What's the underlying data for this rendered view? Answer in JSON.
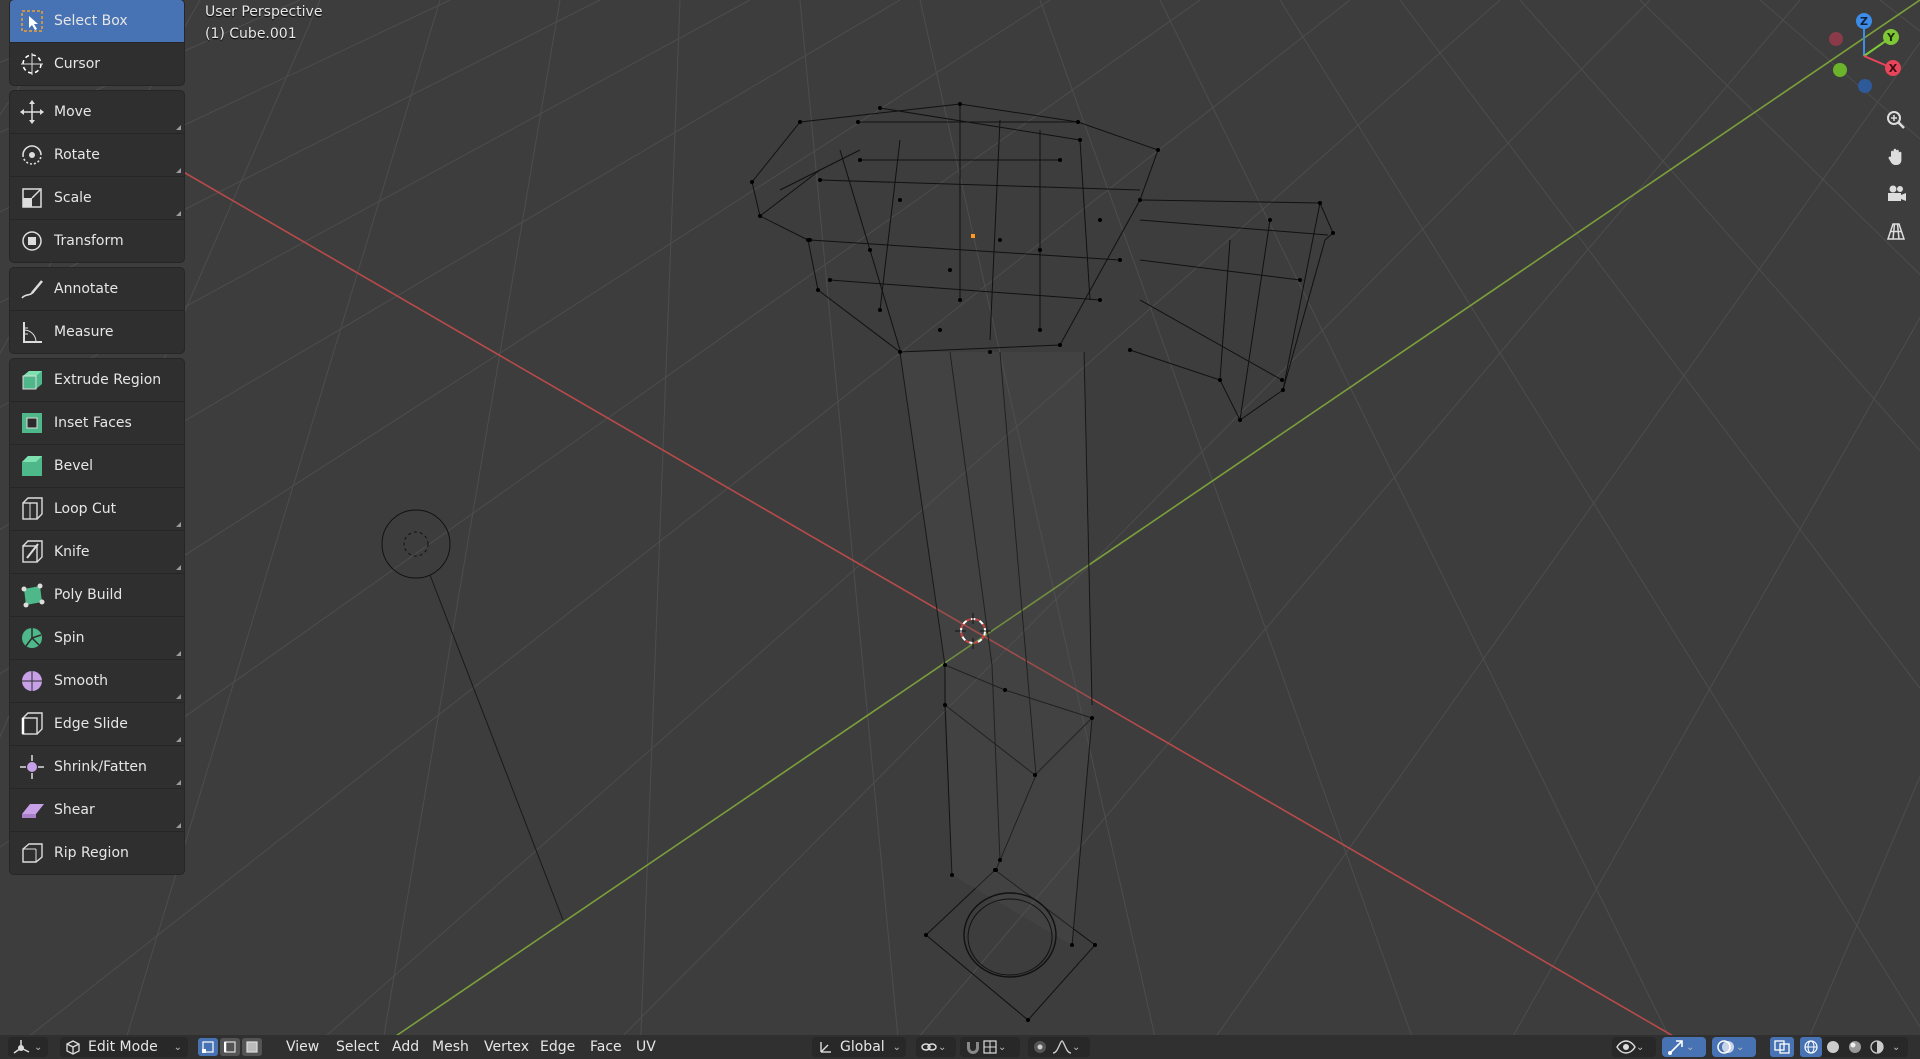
{
  "viewport": {
    "perspective_label": "User Perspective",
    "object_label": "(1) Cube.001"
  },
  "toolbar": {
    "groups": [
      [
        {
          "label": "Select Box",
          "icon": "select-box-icon",
          "active": true
        },
        {
          "label": "Cursor",
          "icon": "cursor-icon"
        }
      ],
      [
        {
          "label": "Move",
          "icon": "move-icon"
        },
        {
          "label": "Rotate",
          "icon": "rotate-icon"
        },
        {
          "label": "Scale",
          "icon": "scale-icon"
        },
        {
          "label": "Transform",
          "icon": "transform-icon"
        }
      ],
      [
        {
          "label": "Annotate",
          "icon": "annotate-icon"
        },
        {
          "label": "Measure",
          "icon": "measure-icon"
        }
      ],
      [
        {
          "label": "Extrude Region",
          "icon": "extrude-region-icon"
        },
        {
          "label": "Inset Faces",
          "icon": "inset-faces-icon"
        },
        {
          "label": "Bevel",
          "icon": "bevel-icon"
        },
        {
          "label": "Loop Cut",
          "icon": "loop-cut-icon"
        },
        {
          "label": "Knife",
          "icon": "knife-icon"
        },
        {
          "label": "Poly Build",
          "icon": "poly-build-icon"
        },
        {
          "label": "Spin",
          "icon": "spin-icon"
        },
        {
          "label": "Smooth",
          "icon": "smooth-icon"
        },
        {
          "label": "Edge Slide",
          "icon": "edge-slide-icon"
        },
        {
          "label": "Shrink/Fatten",
          "icon": "shrink-fatten-icon"
        },
        {
          "label": "Shear",
          "icon": "shear-icon"
        },
        {
          "label": "Rip Region",
          "icon": "rip-region-icon"
        }
      ]
    ]
  },
  "gizmo": {
    "axis_z": "Z",
    "axis_y": "Y",
    "axis_x": "X",
    "colors": {
      "x": "#e8445a",
      "y": "#7fc736",
      "z": "#3d8ce8"
    }
  },
  "nav_buttons": [
    "zoom-icon",
    "hand-pan-icon",
    "camera-icon",
    "grid-ortho-icon"
  ],
  "header": {
    "mode": "Edit Mode",
    "menus": [
      "View",
      "Select",
      "Add",
      "Mesh",
      "Vertex",
      "Edge",
      "Face",
      "UV"
    ],
    "transform_orientation": "Global"
  },
  "colors": {
    "background": "#3d3d3d",
    "grid": "#4d4d4d",
    "axis_x_line": "#b84a4a",
    "axis_y_line": "#7ba03a",
    "active_tool": "#4772b3",
    "toolbar_bg": "#2f2f2f"
  }
}
